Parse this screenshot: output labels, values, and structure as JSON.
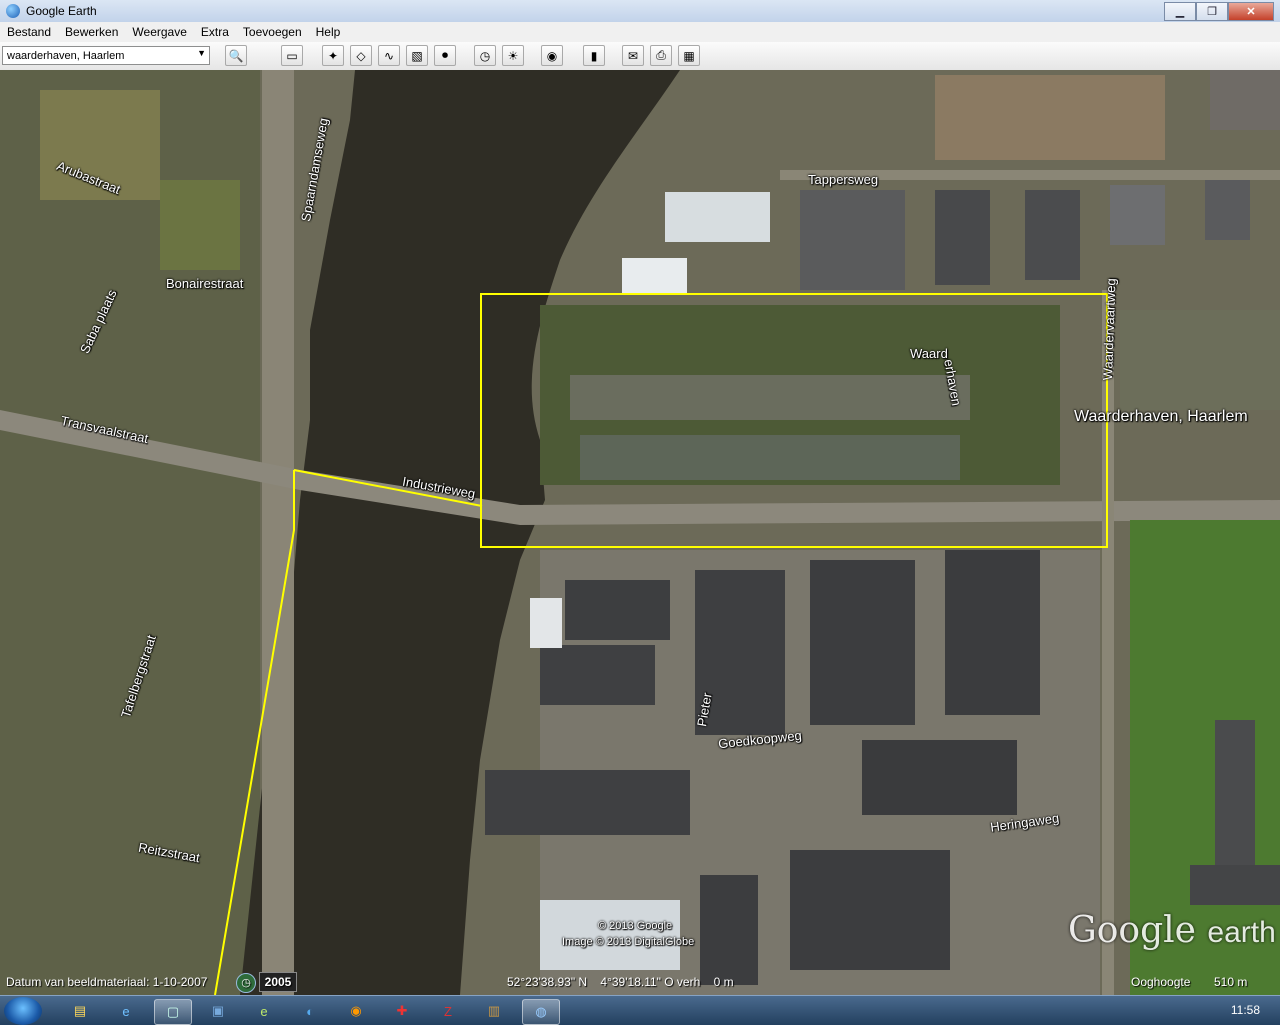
{
  "window": {
    "title": "Google Earth",
    "minimize": "▁",
    "maximize": "❐",
    "close": "✕"
  },
  "menu": [
    "Bestand",
    "Bewerken",
    "Weergave",
    "Extra",
    "Toevoegen",
    "Help"
  ],
  "search": {
    "value": "waarderhaven, Haarlem",
    "dropdown_icon": "▼"
  },
  "toolbar_icons": [
    "search-icon",
    "sidebar-icon",
    "placemark-icon",
    "polygon-icon",
    "path-icon",
    "image-overlay-icon",
    "record-tour-icon",
    "historical-imagery-icon",
    "sunlight-icon",
    "planets-icon",
    "ruler-icon",
    "email-icon",
    "print-icon",
    "maps-icon"
  ],
  "toolbar_glyphs": {
    "search": "🔍",
    "sidebar": "▭",
    "placemark": "✦",
    "polygon": "◇",
    "path": "∿",
    "overlay": "▧",
    "tour": "⏺",
    "history": "◷",
    "sun": "☀",
    "planet": "◉",
    "ruler": "▮",
    "email": "✉",
    "print": "⎙",
    "maps": "▦"
  },
  "map": {
    "streets": [
      "Spaarndamseweg",
      "Arubastraat",
      "Bonairestraat",
      "Sabaplaats",
      "Transvaalstraat",
      "Industrieweg",
      "Tappersweg",
      "Waarderhaven",
      "Waardervaartweg",
      "Tafelbergstraat",
      "Reitzstraat",
      "Pieter Goedkoopweg",
      "Heringaweg"
    ],
    "street_labels": {
      "spaarndamseweg": "Spaarndamseweg",
      "arubastraat": "Arubastraat",
      "bonairestraat": "Bonairestraat",
      "saba": "Saba plaats",
      "transvaal": "Transvaalstraat",
      "industrieweg": "Industrieweg",
      "tappersweg": "Tappersweg",
      "waard": "Waard",
      "haven": "erhaven",
      "waardervaart": "Waardervaartweg",
      "tafelberg": "Tafelbergstraat",
      "reitz": "Reitzstraat",
      "pieter": "Pieter",
      "goedkoop": "Goedkoopweg",
      "heringa": "Heringaweg"
    },
    "place_label": "Waarderhaven, Haarlem",
    "copyright": [
      "© 2013 Google",
      "Image © 2013 DigitalGlobe"
    ],
    "logo_main": "Google",
    "logo_sub": "earth"
  },
  "status": {
    "imagery_date": "Datum van beeldmateriaal: 1-10-2007",
    "history_year": "2005",
    "coordinates": "52°23'38.93\" N    4°39'18.11\" O verh    0 m",
    "eye_alt_label": "Ooghoogte",
    "eye_alt_value": "510 m"
  },
  "taskbar": {
    "clock": "11:58",
    "apps": [
      "explorer",
      "ie",
      "notepad",
      "save",
      "edge",
      "ie-alt",
      "firefox",
      "app-red",
      "filezilla",
      "app-folder",
      "google-earth"
    ]
  },
  "colors": {
    "highlight": "#ffff00",
    "water": "#2e2c24"
  }
}
